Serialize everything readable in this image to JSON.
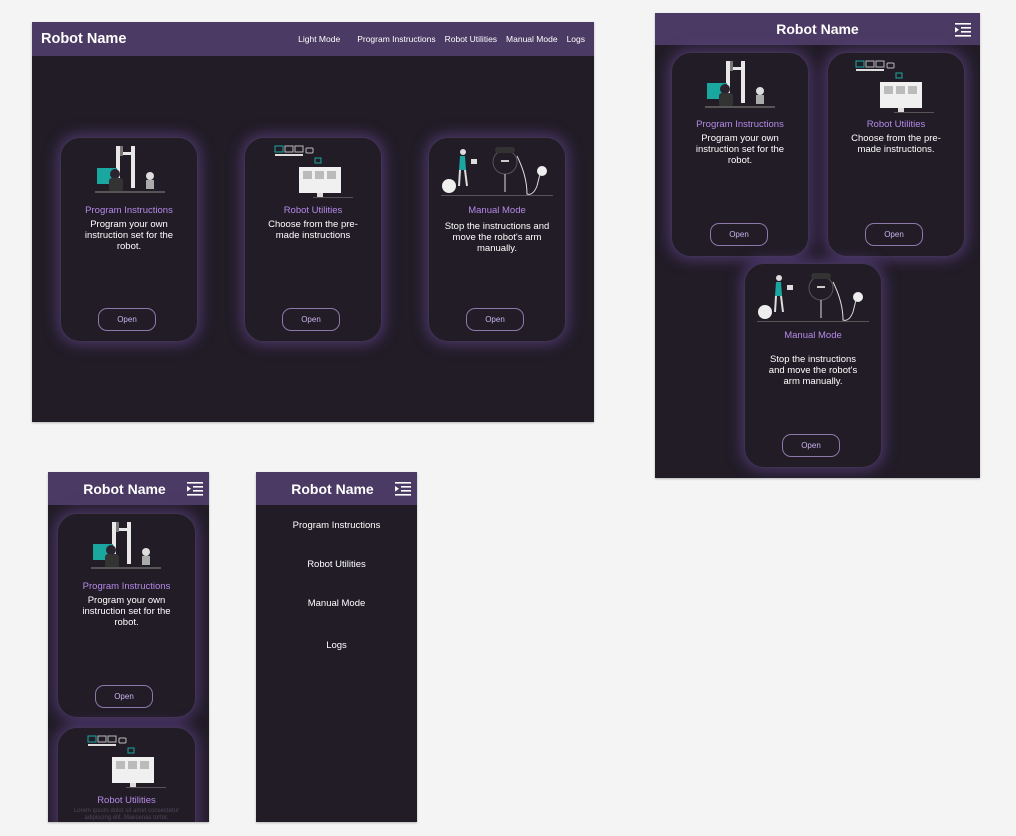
{
  "robot_name": "Robot Name",
  "nav": {
    "light_mode": "Light Mode",
    "program_instructions": "Program Instructions",
    "robot_utilities": "Robot Utilities",
    "manual_mode": "Manual Mode",
    "logs": "Logs"
  },
  "cards": {
    "program": {
      "title": "Program Instructions",
      "desc": "Program your own instruction set for the robot.",
      "button": "Open"
    },
    "utilities": {
      "title": "Robot Utilities",
      "desc": "Choose from the pre-made instructions",
      "desc_tablet": "Choose from the pre-made instructions.",
      "button": "Open"
    },
    "manual": {
      "title": "Manual Mode",
      "desc": "Stop the instructions and move the robot's arm manually.",
      "button": "Open"
    }
  },
  "mobile_placeholder_text": "Lorem ipsum dolor sit amet consectetur adipiscing elit. Maecenas tortor.",
  "colors": {
    "page_bg": "#f4f4f4",
    "app_bg": "#211c26",
    "header_bg": "#4b3a63",
    "accent_text": "#b58ae8",
    "illustration_teal": "#1aa7a0"
  },
  "icons": [
    "hamburger-menu-icon",
    "robot-arm-illustration",
    "computer-monitor-illustration",
    "person-with-robot-illustration"
  ]
}
